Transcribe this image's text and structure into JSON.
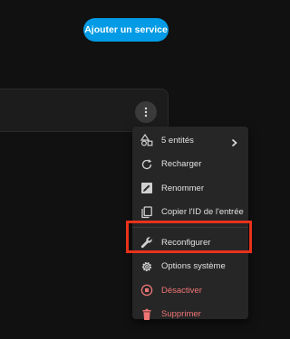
{
  "header": {
    "add_service_label": "Ajouter un service"
  },
  "menu": {
    "items": [
      {
        "label": "5 entités",
        "icon": "shapes-icon"
      },
      {
        "label": "Recharger",
        "icon": "reload-icon"
      },
      {
        "label": "Renommer",
        "icon": "rename-icon"
      },
      {
        "label": "Copier l'ID de l'entrée",
        "icon": "copy-icon"
      },
      {
        "label": "Reconfigurer",
        "icon": "wrench-icon"
      },
      {
        "label": "Options système",
        "icon": "gear-icon"
      },
      {
        "label": "Désactiver",
        "icon": "stop-circle-icon"
      },
      {
        "label": "Supprimer",
        "icon": "trash-icon"
      }
    ]
  },
  "colors": {
    "background": "#111111",
    "accent": "#039be5",
    "danger_text": "#f07575",
    "highlight_outline": "#e8321b"
  }
}
